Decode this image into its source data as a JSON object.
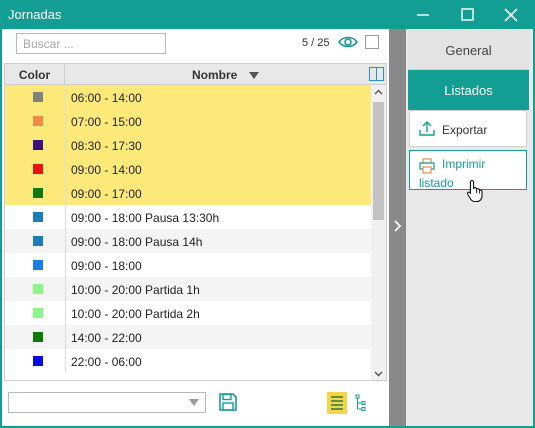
{
  "window": {
    "title": "Jornadas",
    "accent": "#139e93"
  },
  "search": {
    "placeholder": "Buscar ..."
  },
  "counter": "5 / 25",
  "table": {
    "headers": {
      "color": "Color",
      "name": "Nombre"
    },
    "rows": [
      {
        "name": "06:00 - 14:00",
        "color": "#808080",
        "selected": true
      },
      {
        "name": "07:00 - 15:00",
        "color": "#f08a4b",
        "selected": true
      },
      {
        "name": "08:30 - 17:30",
        "color": "#3d0f7a",
        "selected": true
      },
      {
        "name": "09:00 - 14:00",
        "color": "#e81313",
        "selected": true
      },
      {
        "name": "09:00 - 17:00",
        "color": "#0c7a0c",
        "selected": true
      },
      {
        "name": "09:00 - 18:00 Pausa 13:30h",
        "color": "#1a7ebe",
        "selected": false
      },
      {
        "name": "09:00 - 18:00 Pausa 14h",
        "color": "#1a7ebe",
        "selected": false
      },
      {
        "name": "09:00 - 18:00",
        "color": "#1a7ee8",
        "selected": false
      },
      {
        "name": "10:00 - 20:00 Partida 1h",
        "color": "#8ef58e",
        "selected": false
      },
      {
        "name": "10:00 - 20:00 Partida 2h",
        "color": "#8ef58e",
        "selected": false
      },
      {
        "name": "14:00 - 22:00",
        "color": "#0c7a0c",
        "selected": false
      },
      {
        "name": "22:00 - 06:00",
        "color": "#0a0ae8",
        "selected": false
      }
    ],
    "selected_bg": "#fde97a",
    "alt_bg": "#f4f4f4"
  },
  "right_panel": {
    "tabs": [
      {
        "label": "General",
        "active": false
      },
      {
        "label": "Listados",
        "active": true
      }
    ],
    "actions": {
      "export": "Exportar",
      "print": "Imprimir listado"
    }
  },
  "icons": {
    "view": "eye-icon",
    "sort": "sort-down-icon",
    "columns": "columns-icon",
    "save": "save-icon",
    "list": "list-icon",
    "tree": "tree-icon",
    "export": "upload-icon",
    "print": "printer-icon",
    "splitter": "chevron-right-icon",
    "cursor": "hand-pointer-icon"
  }
}
